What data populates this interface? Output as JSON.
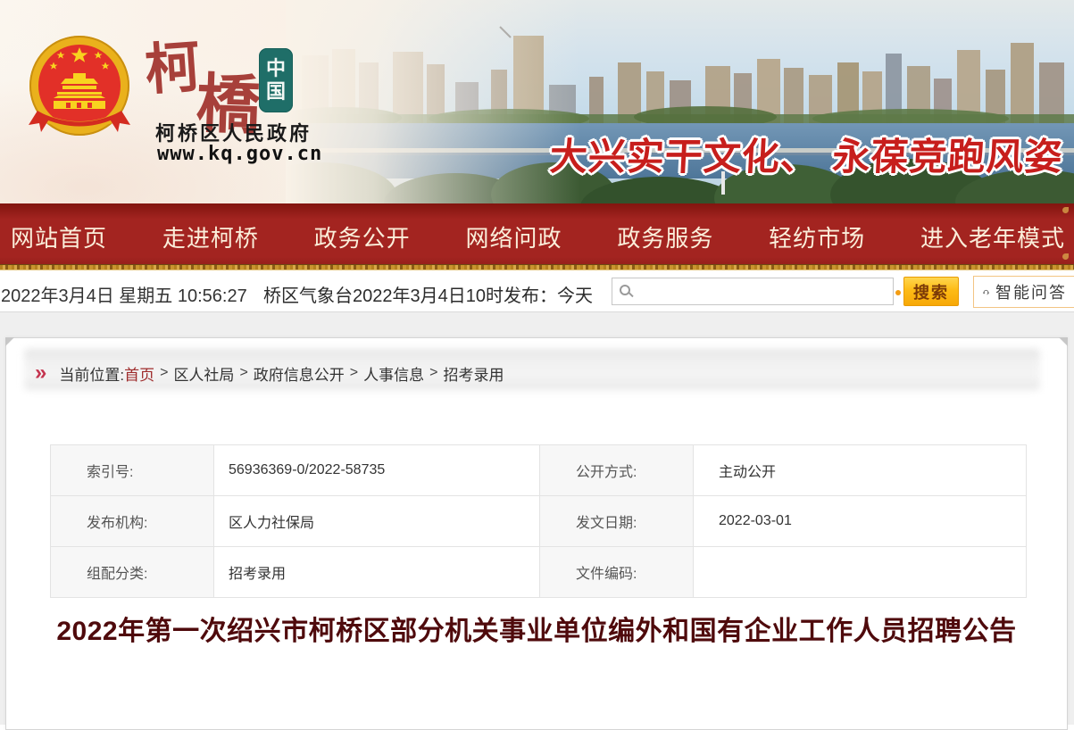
{
  "banner": {
    "emblem_icon": "china-national-emblem",
    "site_calligraphy_char1": "柯",
    "site_calligraphy_char2": "橋",
    "seal_char1": "中",
    "seal_char2": "国",
    "org_name": "柯桥区人民政府",
    "site_url": "www.kq.gov.cn",
    "slogan": "大兴实干文化、 永葆竞跑风姿"
  },
  "nav": {
    "items": [
      {
        "label": "网站首页"
      },
      {
        "label": "走进柯桥"
      },
      {
        "label": "政务公开"
      },
      {
        "label": "网络问政"
      },
      {
        "label": "政务服务"
      },
      {
        "label": "轻纺市场"
      },
      {
        "label": "进入老年模式"
      }
    ]
  },
  "infobar": {
    "datetime": "2022年3月4日 星期五 10:56:27",
    "weather_bulletin": "桥区气象台2022年3月4日10时发布：今天",
    "search_placeholder": "",
    "search_button_label": "搜索",
    "smart_qa_label": "智能问答"
  },
  "breadcrumb": {
    "marker": "»",
    "prefix": "当前位置:",
    "separator": ">",
    "items": [
      {
        "label": "首页"
      },
      {
        "label": "区人社局"
      },
      {
        "label": "政府信息公开"
      },
      {
        "label": "人事信息"
      },
      {
        "label": "招考录用"
      }
    ]
  },
  "meta_table": {
    "rows": [
      {
        "c0_label": "索引号:",
        "c0_value": "56936369-0/2022-58735",
        "c1_label": "公开方式:",
        "c1_value": "主动公开"
      },
      {
        "c0_label": "发布机构:",
        "c0_value": "区人力社保局",
        "c1_label": "发文日期:",
        "c1_value": "2022-03-01"
      },
      {
        "c0_label": "组配分类:",
        "c0_value": "招考录用",
        "c1_label": "文件编码:",
        "c1_value": ""
      }
    ]
  },
  "article": {
    "title": "2022年第一次绍兴市柯桥区部分机关事业单位编外和国有企业工作人员招聘公告"
  },
  "colors": {
    "nav_red": "#a32420",
    "gold_band": "#c9952f",
    "search_yellow": "#fdbb16",
    "title_maroon": "#4f0a0c",
    "breadcrumb_home_red": "#9e2b2b"
  }
}
